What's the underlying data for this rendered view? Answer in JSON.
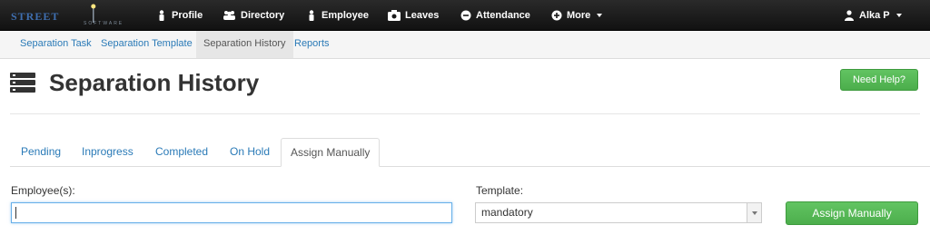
{
  "app": {
    "logo_text": "STREET",
    "logo_sub": "SOFTWARE"
  },
  "topnav": {
    "items": [
      {
        "label": "Profile",
        "icon": "user-icon"
      },
      {
        "label": "Directory",
        "icon": "users-icon"
      },
      {
        "label": "Employee",
        "icon": "user-icon"
      },
      {
        "label": "Leaves",
        "icon": "camera-icon"
      },
      {
        "label": "Attendance",
        "icon": "minus-circle-icon"
      },
      {
        "label": "More",
        "icon": "plus-circle-icon"
      }
    ],
    "user": {
      "label": "Alka P",
      "icon": "user-icon"
    }
  },
  "subnav": {
    "items": [
      {
        "label": "Separation Task"
      },
      {
        "label": "Separation Template"
      },
      {
        "label": "Separation History"
      },
      {
        "label": "Reports"
      }
    ],
    "active_index": 2
  },
  "page": {
    "title": "Separation History",
    "title_icon": "server-icon",
    "help_label": "Need Help?"
  },
  "tabs": {
    "items": [
      {
        "label": "Pending"
      },
      {
        "label": "Inprogress"
      },
      {
        "label": "Completed"
      },
      {
        "label": "On Hold"
      },
      {
        "label": "Assign Manually"
      }
    ],
    "active_index": 4
  },
  "form": {
    "employee_label": "Employee(s):",
    "employee_value": "",
    "template_label": "Template:",
    "template_selected": "mandatory",
    "assign_label": "Assign Manually"
  },
  "colors": {
    "link": "#2a7ab7",
    "success": "#5cb85c",
    "navbar": "#1a1a1a"
  }
}
